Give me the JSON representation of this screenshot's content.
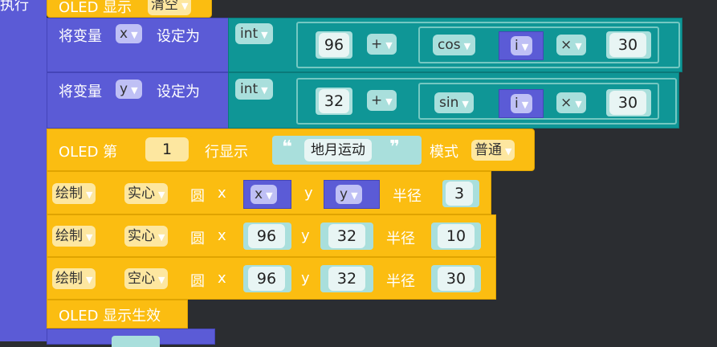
{
  "loop": {
    "label": "执行"
  },
  "oled_clear": {
    "label": "OLED 显示",
    "option": "清空"
  },
  "set_x": {
    "label": "将变量",
    "var": "x",
    "suffix": "设定为",
    "type": "int",
    "base": "96",
    "op": "+",
    "func": "cos",
    "arg": "i",
    "mul": "×",
    "factor": "30"
  },
  "set_y": {
    "label": "将变量",
    "var": "y",
    "suffix": "设定为",
    "type": "int",
    "base": "32",
    "op": "+",
    "func": "sin",
    "arg": "i",
    "mul": "×",
    "factor": "30"
  },
  "oled_line": {
    "prefix": "OLED 第",
    "line": "1",
    "mid": "行显示",
    "text": "地月运动",
    "mode_label": "模式",
    "mode": "普通"
  },
  "draw1": {
    "action": "绘制",
    "fill": "实心",
    "shape": "圆",
    "x_label": "x",
    "x": "x",
    "y_label": "y",
    "y": "y",
    "r_label": "半径",
    "r": "3"
  },
  "draw2": {
    "action": "绘制",
    "fill": "实心",
    "shape": "圆",
    "x_label": "x",
    "x": "96",
    "y_label": "y",
    "y": "32",
    "r_label": "半径",
    "r": "10"
  },
  "draw3": {
    "action": "绘制",
    "fill": "空心",
    "shape": "圆",
    "x_label": "x",
    "x": "96",
    "y_label": "y",
    "y": "32",
    "r_label": "半径",
    "r": "30"
  },
  "oled_show": {
    "label": "OLED 显示生效"
  },
  "colors": {
    "workspace": "#2b2d31",
    "oled": "#fbbd11",
    "variables": "#5b5bd6",
    "math": "#0f9696"
  }
}
